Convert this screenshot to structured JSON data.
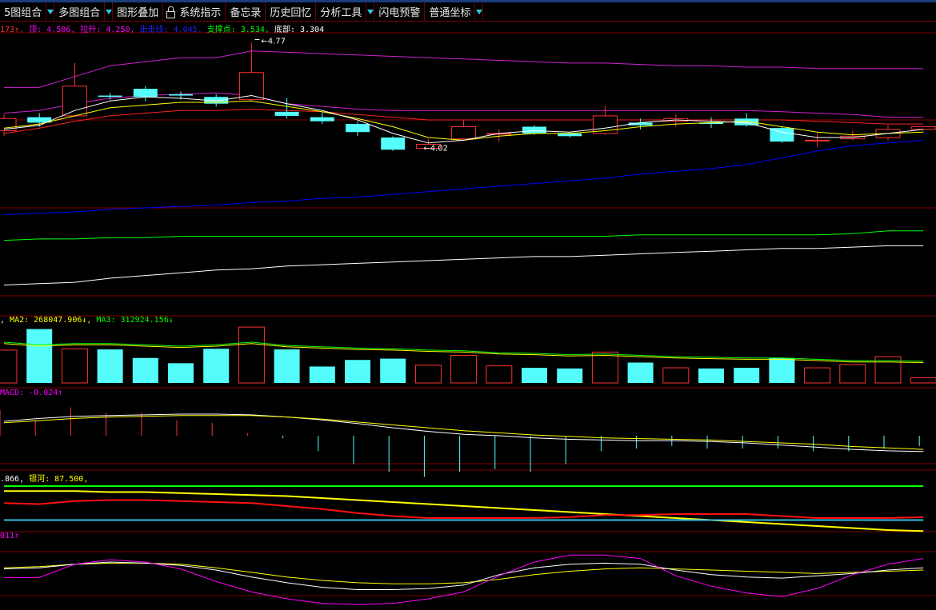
{
  "toolbar": {
    "items": [
      {
        "label": "5图组合",
        "dropdown": true
      },
      {
        "label": "多图组合",
        "dropdown": true
      },
      {
        "label": "图形叠加",
        "dropdown": false
      },
      {
        "label": "系统指示",
        "dropdown": false,
        "icon": "lock-icon"
      },
      {
        "label": "备忘录",
        "dropdown": false
      },
      {
        "label": "历史回忆",
        "dropdown": false
      },
      {
        "label": "分析工具",
        "dropdown": true
      },
      {
        "label": "闪电预警",
        "dropdown": false
      },
      {
        "label": "普通坐标",
        "dropdown": true
      }
    ]
  },
  "main_info": {
    "first": "173↑",
    "top": "顶: 4.506",
    "pull": "拉升: 4.250",
    "attack": "出击线: 4.045",
    "support": "支撑点: 3.534",
    "bottom": "底部: 3.304"
  },
  "annotations": {
    "high": "4.77",
    "low": "4.02"
  },
  "vol_info": {
    "ma2": "MA2: 268047.906↓",
    "ma3": "MA3: 312924.156↓"
  },
  "macd_info": {
    "macd": "MACD: -0.024↑"
  },
  "ind4_info": {
    "v1": ".866",
    "galaxy": "银河: 87.500"
  },
  "ind5_info": {
    "v1": "011↑"
  },
  "colors": {
    "up": "#ff3232",
    "down": "#54fcfc",
    "grid": "#800000",
    "magenta": "#ff00ff",
    "blue": "#0000ff",
    "green": "#00ff00",
    "yellow": "#ffff00",
    "white": "#ffffff"
  },
  "chart_data": {
    "type": "candlestick",
    "candles": [
      {
        "o": 4.12,
        "c": 4.21,
        "h": 4.24,
        "l": 4.08
      },
      {
        "o": 4.22,
        "c": 4.18,
        "h": 4.25,
        "l": 4.15
      },
      {
        "o": 4.23,
        "c": 4.45,
        "h": 4.62,
        "l": 4.22
      },
      {
        "o": 4.38,
        "c": 4.37,
        "h": 4.4,
        "l": 4.35
      },
      {
        "o": 4.43,
        "c": 4.37,
        "h": 4.45,
        "l": 4.34
      },
      {
        "o": 4.39,
        "c": 4.38,
        "h": 4.41,
        "l": 4.35
      },
      {
        "o": 4.37,
        "c": 4.32,
        "h": 4.39,
        "l": 4.3
      },
      {
        "o": 4.35,
        "c": 4.55,
        "h": 4.77,
        "l": 4.34
      },
      {
        "o": 4.26,
        "c": 4.23,
        "h": 4.36,
        "l": 4.21
      },
      {
        "o": 4.22,
        "c": 4.19,
        "h": 4.26,
        "l": 4.17
      },
      {
        "o": 4.17,
        "c": 4.11,
        "h": 4.19,
        "l": 4.08
      },
      {
        "o": 4.07,
        "c": 3.98,
        "h": 4.08,
        "l": 3.97
      },
      {
        "o": 3.99,
        "c": 4.02,
        "h": 4.06,
        "l": 4.02
      },
      {
        "o": 4.06,
        "c": 4.15,
        "h": 4.2,
        "l": 4.05
      },
      {
        "o": 4.1,
        "c": 4.1,
        "h": 4.13,
        "l": 4.04
      },
      {
        "o": 4.15,
        "c": 4.1,
        "h": 4.16,
        "l": 4.09
      },
      {
        "o": 4.1,
        "c": 4.08,
        "h": 4.11,
        "l": 4.07
      },
      {
        "o": 4.1,
        "c": 4.23,
        "h": 4.3,
        "l": 4.09
      },
      {
        "o": 4.18,
        "c": 4.16,
        "h": 4.21,
        "l": 4.13
      },
      {
        "o": 4.19,
        "c": 4.21,
        "h": 4.24,
        "l": 4.15
      },
      {
        "o": 4.18,
        "c": 4.17,
        "h": 4.22,
        "l": 4.14
      },
      {
        "o": 4.21,
        "c": 4.16,
        "h": 4.25,
        "l": 4.15
      },
      {
        "o": 4.14,
        "c": 4.04,
        "h": 4.15,
        "l": 4.03
      },
      {
        "o": 4.05,
        "c": 4.05,
        "h": 4.1,
        "l": 4.0
      },
      {
        "o": 4.06,
        "c": 4.08,
        "h": 4.12,
        "l": 4.05
      },
      {
        "o": 4.07,
        "c": 4.13,
        "h": 4.16,
        "l": 4.05
      },
      {
        "o": 4.13,
        "c": 4.15,
        "h": 4.15,
        "l": 4.12
      }
    ],
    "lines": {
      "magenta_upper": [
        4.44,
        4.44,
        4.52,
        4.6,
        4.63,
        4.66,
        4.66,
        4.71,
        4.7,
        4.69,
        4.68,
        4.67,
        4.66,
        4.65,
        4.64,
        4.63,
        4.62,
        4.62,
        4.61,
        4.6,
        4.6,
        4.59,
        4.59,
        4.58,
        4.58,
        4.58,
        4.58
      ],
      "magenta_mid": [
        4.25,
        4.27,
        4.32,
        4.36,
        4.38,
        4.39,
        4.4,
        4.38,
        4.32,
        4.3,
        4.28,
        4.27,
        4.27,
        4.27,
        4.27,
        4.27,
        4.27,
        4.27,
        4.27,
        4.27,
        4.27,
        4.27,
        4.26,
        4.25,
        4.24,
        4.22,
        4.22
      ],
      "red_ma": [
        4.1,
        4.14,
        4.19,
        4.23,
        4.25,
        4.27,
        4.27,
        4.28,
        4.27,
        4.26,
        4.24,
        4.22,
        4.2,
        4.2,
        4.2,
        4.2,
        4.2,
        4.2,
        4.2,
        4.2,
        4.2,
        4.2,
        4.2,
        4.19,
        4.18,
        4.17,
        4.17
      ],
      "yellow_ma": [
        4.14,
        4.17,
        4.23,
        4.29,
        4.31,
        4.33,
        4.33,
        4.34,
        4.3,
        4.26,
        4.21,
        4.15,
        4.07,
        4.05,
        4.08,
        4.1,
        4.1,
        4.12,
        4.15,
        4.17,
        4.18,
        4.19,
        4.15,
        4.11,
        4.09,
        4.1,
        4.11
      ],
      "white_ma": [
        4.13,
        4.16,
        4.27,
        4.34,
        4.37,
        4.36,
        4.34,
        4.38,
        4.32,
        4.27,
        4.2,
        4.1,
        4.03,
        4.05,
        4.1,
        4.12,
        4.11,
        4.14,
        4.18,
        4.2,
        4.19,
        4.18,
        4.11,
        4.07,
        4.07,
        4.1,
        4.13
      ],
      "blue": [
        3.5,
        3.51,
        3.52,
        3.54,
        3.55,
        3.56,
        3.57,
        3.59,
        3.6,
        3.62,
        3.63,
        3.65,
        3.67,
        3.69,
        3.71,
        3.73,
        3.75,
        3.77,
        3.8,
        3.82,
        3.84,
        3.87,
        3.92,
        3.97,
        4.01,
        4.03,
        4.05
      ],
      "green": [
        3.31,
        3.32,
        3.32,
        3.33,
        3.33,
        3.34,
        3.34,
        3.34,
        3.34,
        3.34,
        3.34,
        3.34,
        3.34,
        3.34,
        3.34,
        3.34,
        3.34,
        3.34,
        3.35,
        3.35,
        3.35,
        3.35,
        3.35,
        3.35,
        3.36,
        3.38,
        3.38
      ],
      "white_low": [
        2.98,
        2.99,
        3.0,
        3.03,
        3.05,
        3.07,
        3.09,
        3.1,
        3.12,
        3.13,
        3.14,
        3.15,
        3.16,
        3.17,
        3.18,
        3.19,
        3.19,
        3.2,
        3.21,
        3.22,
        3.23,
        3.24,
        3.25,
        3.25,
        3.26,
        3.27,
        3.27
      ]
    },
    "volume": [
      50,
      82,
      52,
      51,
      38,
      30,
      52,
      85,
      51,
      25,
      35,
      37,
      27,
      42,
      26,
      23,
      22,
      47,
      31,
      23,
      22,
      23,
      38,
      23,
      28,
      40,
      8
    ],
    "volume_ma": [
      62,
      58,
      60,
      60,
      58,
      56,
      58,
      62,
      57,
      55,
      53,
      52,
      50,
      49,
      46,
      45,
      43,
      44,
      42,
      40,
      39,
      38,
      38,
      36,
      34,
      34,
      33
    ],
    "macd_hist": [
      0.01,
      0.006,
      0.011,
      0.009,
      0.009,
      0.006,
      0.005,
      0.001,
      -0.001,
      -0.006,
      -0.011,
      -0.014,
      -0.016,
      -0.014,
      -0.013,
      -0.014,
      -0.011,
      -0.006,
      -0.005,
      -0.004,
      -0.005,
      -0.005,
      -0.005,
      -0.006,
      -0.006,
      -0.005,
      -0.004
    ],
    "macd_dif": [
      0.02,
      0.024,
      0.027,
      0.028,
      0.029,
      0.03,
      0.03,
      0.029,
      0.026,
      0.022,
      0.017,
      0.011,
      0.006,
      0.002,
      0.0,
      -0.003,
      -0.005,
      -0.006,
      -0.007,
      -0.007,
      -0.008,
      -0.01,
      -0.013,
      -0.016,
      -0.019,
      -0.021,
      -0.022
    ],
    "macd_dea": [
      0.018,
      0.021,
      0.024,
      0.026,
      0.027,
      0.028,
      0.028,
      0.028,
      0.026,
      0.023,
      0.019,
      0.015,
      0.011,
      0.007,
      0.004,
      0.001,
      -0.001,
      -0.003,
      -0.004,
      -0.005,
      -0.006,
      -0.008,
      -0.01,
      -0.012,
      -0.015,
      -0.017,
      -0.019
    ],
    "ind4": {
      "green": [
        100,
        100,
        100,
        100,
        100,
        100,
        100,
        100,
        100,
        100,
        100,
        100,
        100,
        100,
        100,
        100,
        100,
        100,
        100,
        100,
        100,
        100,
        100,
        100,
        100,
        100,
        100
      ],
      "yellow": [
        95,
        95,
        95,
        94,
        94,
        93,
        92,
        91,
        90,
        88,
        86,
        84,
        82,
        80,
        78,
        76,
        74,
        72,
        70,
        68,
        66,
        64,
        62,
        60,
        58,
        56,
        55
      ],
      "red": [
        83,
        82,
        85,
        86,
        86,
        85,
        84,
        83,
        80,
        77,
        73,
        70,
        68,
        68,
        68,
        68,
        69,
        71,
        71,
        72,
        72,
        72,
        70,
        68,
        68,
        68,
        69
      ],
      "cyan": [
        66,
        66,
        66,
        66,
        66,
        66,
        66,
        66,
        66,
        66,
        66,
        66,
        66,
        66,
        66,
        66,
        66,
        66,
        66,
        66,
        66,
        66,
        66,
        66,
        66,
        66,
        66
      ]
    },
    "ind5": {
      "magenta": [
        55,
        55,
        78,
        86,
        82,
        70,
        48,
        30,
        18,
        10,
        8,
        10,
        18,
        30,
        58,
        82,
        94,
        94,
        88,
        58,
        40,
        28,
        22,
        36,
        60,
        78,
        88
      ],
      "white": [
        70,
        72,
        78,
        82,
        80,
        76,
        68,
        56,
        46,
        38,
        34,
        34,
        36,
        42,
        60,
        72,
        78,
        80,
        78,
        68,
        60,
        56,
        54,
        58,
        62,
        68,
        72
      ],
      "yellow": [
        72,
        74,
        78,
        80,
        80,
        78,
        72,
        64,
        56,
        50,
        46,
        44,
        44,
        46,
        52,
        60,
        66,
        70,
        72,
        70,
        68,
        66,
        64,
        62,
        64,
        66,
        68
      ]
    }
  }
}
